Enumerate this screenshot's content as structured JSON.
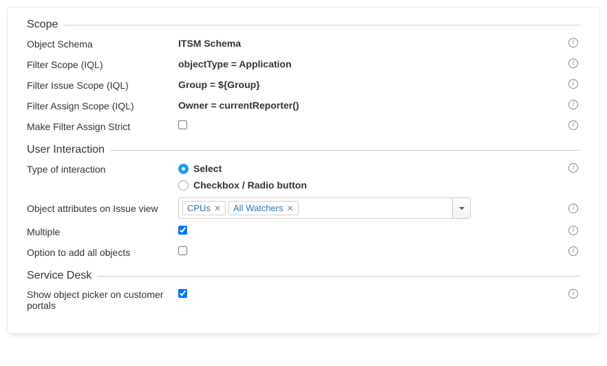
{
  "sections": {
    "scope": {
      "title": "Scope",
      "rows": {
        "objectSchema": {
          "label": "Object Schema",
          "value": "ITSM Schema"
        },
        "filterScope": {
          "label": "Filter Scope (IQL)",
          "value": "objectType = Application"
        },
        "filterIssueScope": {
          "label": "Filter Issue Scope (IQL)",
          "value": "Group = ${Group}"
        },
        "filterAssignScope": {
          "label": "Filter Assign Scope (IQL)",
          "value": "Owner = currentReporter()"
        },
        "makeFilterAssignStrict": {
          "label": "Make Filter Assign Strict",
          "checked": false
        }
      }
    },
    "userInteraction": {
      "title": "User Interaction",
      "rows": {
        "typeOfInteraction": {
          "label": "Type of interaction",
          "options": {
            "select": "Select",
            "checkbox": "Checkbox / Radio button"
          },
          "selected": "select"
        },
        "objectAttributes": {
          "label": "Object attributes on Issue view",
          "tags": [
            "CPUs",
            "All Watchers"
          ]
        },
        "multiple": {
          "label": "Multiple",
          "checked": true
        },
        "optionAddAll": {
          "label": "Option to add all objects",
          "checked": false
        }
      }
    },
    "serviceDesk": {
      "title": "Service Desk",
      "rows": {
        "showPicker": {
          "label": "Show object picker on customer portals",
          "checked": true
        }
      }
    }
  },
  "infoGlyph": "i"
}
